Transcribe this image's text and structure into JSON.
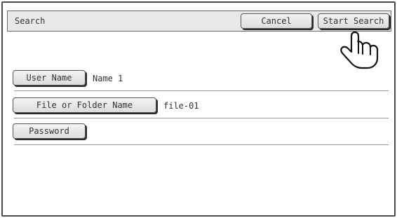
{
  "header": {
    "title": "Search",
    "cancel_label": "Cancel",
    "start_search_label": "Start Search"
  },
  "fields": [
    {
      "button_label": "User Name",
      "value": "Name 1"
    },
    {
      "button_label": "File or Folder Name",
      "value": "file-01"
    },
    {
      "button_label": "Password",
      "value": ""
    }
  ],
  "cursor": {
    "icon": "pointing-hand-cursor-icon"
  }
}
